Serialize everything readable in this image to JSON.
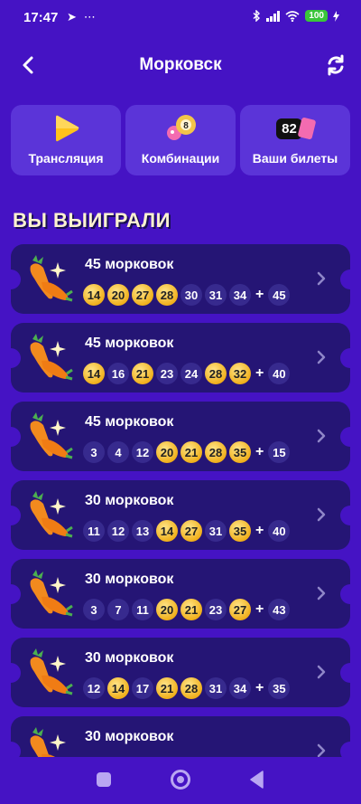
{
  "status_bar": {
    "time": "17:47",
    "left_icons": [
      "telegram-icon",
      "more-icon"
    ],
    "left_glyphs": [
      "➤",
      "⋯"
    ],
    "battery": "100"
  },
  "header": {
    "title": "Морковск"
  },
  "tiles": [
    {
      "label": "Трансляция",
      "icon": "play-icon"
    },
    {
      "label": "Комбинации",
      "icon": "lottery-balls-icon"
    },
    {
      "label": "Ваши билеты",
      "icon": "tickets-icon",
      "count": "82"
    }
  ],
  "won_title": "ВЫ ВЫИГРАЛИ",
  "tickets": [
    {
      "prize": "45 морковок",
      "numbers": [
        {
          "n": "14",
          "hit": true
        },
        {
          "n": "20",
          "hit": true
        },
        {
          "n": "27",
          "hit": true
        },
        {
          "n": "28",
          "hit": true
        },
        {
          "n": "30",
          "hit": false
        },
        {
          "n": "31",
          "hit": false
        },
        {
          "n": "34",
          "hit": false
        }
      ],
      "plus": "+",
      "bonus": "45"
    },
    {
      "prize": "45 морковок",
      "numbers": [
        {
          "n": "14",
          "hit": true
        },
        {
          "n": "16",
          "hit": false
        },
        {
          "n": "21",
          "hit": true
        },
        {
          "n": "23",
          "hit": false
        },
        {
          "n": "24",
          "hit": false
        },
        {
          "n": "28",
          "hit": true
        },
        {
          "n": "32",
          "hit": true
        }
      ],
      "plus": "+",
      "bonus": "40"
    },
    {
      "prize": "45 морковок",
      "numbers": [
        {
          "n": "3",
          "hit": false
        },
        {
          "n": "4",
          "hit": false
        },
        {
          "n": "12",
          "hit": false
        },
        {
          "n": "20",
          "hit": true
        },
        {
          "n": "21",
          "hit": true
        },
        {
          "n": "28",
          "hit": true
        },
        {
          "n": "35",
          "hit": true
        }
      ],
      "plus": "+",
      "bonus": "15"
    },
    {
      "prize": "30 морковок",
      "numbers": [
        {
          "n": "11",
          "hit": false
        },
        {
          "n": "12",
          "hit": false
        },
        {
          "n": "13",
          "hit": false
        },
        {
          "n": "14",
          "hit": true
        },
        {
          "n": "27",
          "hit": true
        },
        {
          "n": "31",
          "hit": false
        },
        {
          "n": "35",
          "hit": true
        }
      ],
      "plus": "+",
      "bonus": "40"
    },
    {
      "prize": "30 морковок",
      "numbers": [
        {
          "n": "3",
          "hit": false
        },
        {
          "n": "7",
          "hit": false
        },
        {
          "n": "11",
          "hit": false
        },
        {
          "n": "20",
          "hit": true
        },
        {
          "n": "21",
          "hit": true
        },
        {
          "n": "23",
          "hit": false
        },
        {
          "n": "27",
          "hit": true
        }
      ],
      "plus": "+",
      "bonus": "43"
    },
    {
      "prize": "30 морковок",
      "numbers": [
        {
          "n": "12",
          "hit": false
        },
        {
          "n": "14",
          "hit": true
        },
        {
          "n": "17",
          "hit": false
        },
        {
          "n": "21",
          "hit": true
        },
        {
          "n": "28",
          "hit": true
        },
        {
          "n": "31",
          "hit": false
        },
        {
          "n": "34",
          "hit": false
        }
      ],
      "plus": "+",
      "bonus": "35"
    },
    {
      "prize": "30 морковок",
      "numbers": [],
      "plus": "",
      "bonus": ""
    }
  ],
  "colors": {
    "background": "#4513c4",
    "tile": "#5b34d8",
    "ticket": "#251575",
    "ball": "#372a8e",
    "ball_hit": "#f0b01c"
  }
}
